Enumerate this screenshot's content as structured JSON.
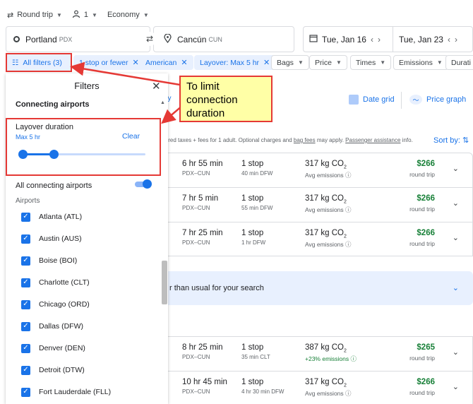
{
  "trip": {
    "type_label": "Round trip",
    "passengers": "1",
    "cabin": "Economy"
  },
  "search": {
    "origin_city": "Portland",
    "origin_code": "PDX",
    "dest_city": "Cancún",
    "dest_code": "CUN",
    "depart_date": "Tue, Jan 16",
    "return_date": "Tue, Jan 23"
  },
  "chips": {
    "all_filters": "All filters (3)",
    "stops": "1 stop or fewer",
    "airline": "American",
    "layover": "Layover: Max 5 hr",
    "bags": "Bags",
    "price": "Price",
    "times": "Times",
    "emissions": "Emissions",
    "duration": "Durati"
  },
  "filters": {
    "title": "Filters",
    "section": "Connecting airports",
    "layover_title": "Layover duration",
    "layover_value": "Max 5 hr",
    "clear": "Clear",
    "slider_low_fraction": 0.0,
    "slider_high_fraction": 0.27,
    "all_connecting": "All connecting airports",
    "airports_label": "Airports",
    "airports": [
      "Atlanta (ATL)",
      "Austin (AUS)",
      "Boise (BOI)",
      "Charlotte (CLT)",
      "Chicago (ORD)",
      "Dallas (DFW)",
      "Denver (DEN)",
      "Detroit (DTW)",
      "Fort Lauderdale (FLL)"
    ]
  },
  "callout": {
    "text": "To limit connection duration"
  },
  "results": {
    "date_grid": "Date grid",
    "price_graph": "Price graph",
    "fees_text": "uired taxes + fees for 1 adult. Optional charges and",
    "bag_fees": "bag fees",
    "fees_mid": "may apply.",
    "assistance": "Passenger assistance",
    "fees_end": "info.",
    "sort_by": "Sort by:",
    "hint_partial": "ny",
    "banner": "r than usual for your search",
    "flights": [
      {
        "duration": "6 hr 55 min",
        "route": "PDX–CUN",
        "stops": "1 stop",
        "via": "40 min DFW",
        "co2": "317 kg CO",
        "emissions": "Avg emissions ⓘ",
        "price": "$266",
        "price_type": "round trip"
      },
      {
        "duration": "7 hr 5 min",
        "route": "PDX–CUN",
        "stops": "1 stop",
        "via": "55 min DFW",
        "co2": "317 kg CO",
        "emissions": "Avg emissions ⓘ",
        "price": "$266",
        "price_type": "round trip"
      },
      {
        "duration": "7 hr 25 min",
        "route": "PDX–CUN",
        "stops": "1 stop",
        "via": "1 hr DFW",
        "co2": "317 kg CO",
        "emissions": "Avg emissions ⓘ",
        "price": "$266",
        "price_type": "round trip"
      },
      {
        "duration": "8 hr 25 min",
        "route": "PDX–CUN",
        "stops": "1 stop",
        "via": "35 min CLT",
        "co2": "387 kg CO",
        "emissions": "+23% emissions ⓘ",
        "price": "$265",
        "price_type": "round trip"
      },
      {
        "duration": "10 hr 45 min",
        "route": "PDX–CUN",
        "stops": "1 stop",
        "via": "4 hr 30 min DFW",
        "co2": "317 kg CO",
        "emissions": "Avg emissions ⓘ",
        "price": "$266",
        "price_type": "round trip"
      }
    ]
  },
  "colors": {
    "accent": "#1a73e8",
    "highlight_red": "#e53935",
    "callout_bg": "#ffffa6",
    "price_green": "#188038"
  }
}
